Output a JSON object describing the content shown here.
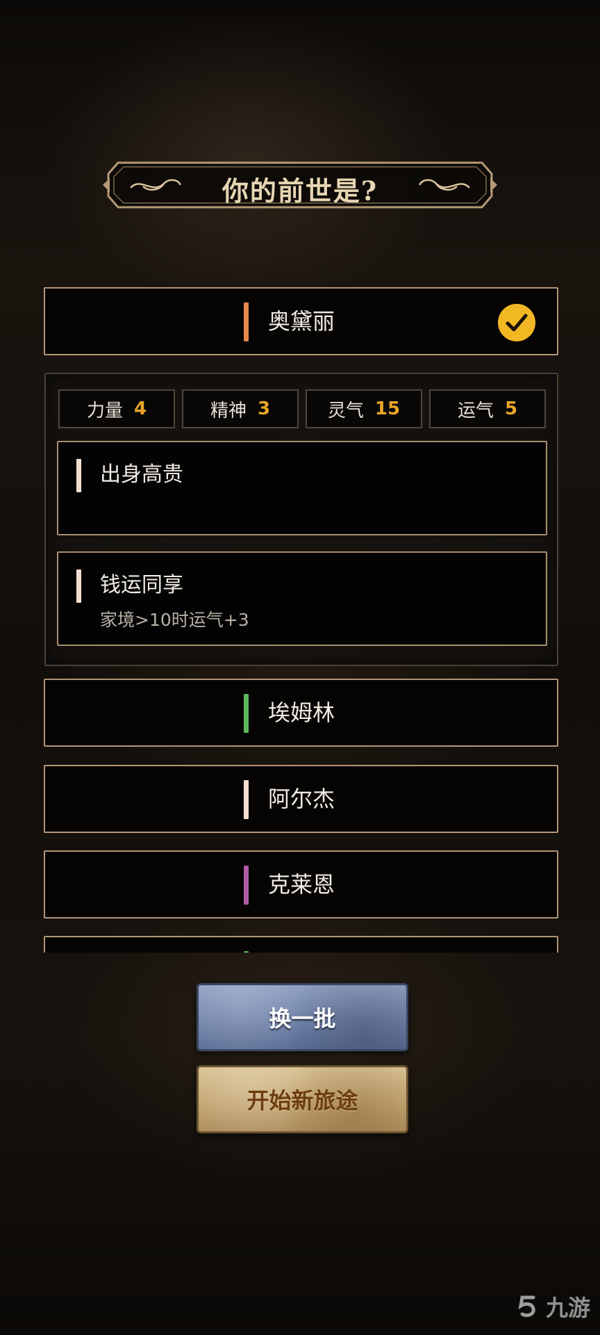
{
  "title": "你的前世是?",
  "characters": [
    {
      "name": "奥黛丽",
      "bar_color": "#e58a4a",
      "selected": true
    },
    {
      "name": "埃姆林",
      "bar_color": "#5fb85a",
      "selected": false
    },
    {
      "name": "阿尔杰",
      "bar_color": "#f3dfd2",
      "selected": false
    },
    {
      "name": "克莱恩",
      "bar_color": "#b15aa8",
      "selected": false
    },
    {
      "name": "",
      "bar_color": "#5fb85a",
      "selected": false
    }
  ],
  "stats": [
    {
      "label": "力量",
      "value": "4"
    },
    {
      "label": "精神",
      "value": "3"
    },
    {
      "label": "灵气",
      "value": "15"
    },
    {
      "label": "运气",
      "value": "5"
    }
  ],
  "traits": [
    {
      "name": "出身高贵",
      "desc": ""
    },
    {
      "name": "钱运同享",
      "desc": "家境>10时运气+3"
    }
  ],
  "buttons": {
    "refresh": "换一批",
    "start": "开始新旅途"
  },
  "watermark": "九游",
  "colors": {
    "frame_gold": "#b39577",
    "stat_value": "#e9a62a",
    "check_badge": "#f2b824"
  }
}
